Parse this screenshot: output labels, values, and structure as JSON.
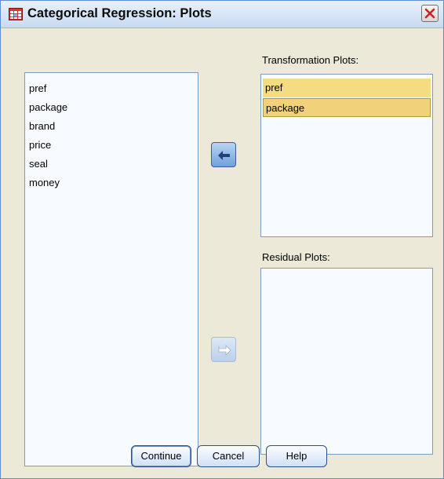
{
  "window": {
    "title": "Categorical Regression: Plots",
    "app_icon": "spss-table-icon",
    "close_icon": "close-icon"
  },
  "source_list": {
    "items": [
      "pref",
      "package",
      "brand",
      "price",
      "seal",
      "money"
    ]
  },
  "transformation": {
    "label": "Transformation Plots:",
    "items": [
      "pref",
      "package"
    ],
    "selected": [
      "pref",
      "package"
    ]
  },
  "residual": {
    "label": "Residual Plots:",
    "items": []
  },
  "arrows": {
    "move_to_transformation": "arrow-left-icon",
    "move_to_residual": "arrow-right-icon"
  },
  "buttons": {
    "continue": "Continue",
    "cancel": "Cancel",
    "help": "Help"
  },
  "colors": {
    "selected_item": "#f4dc82",
    "list_background": "#f7fbff",
    "dialog_background": "#ece9d8"
  }
}
